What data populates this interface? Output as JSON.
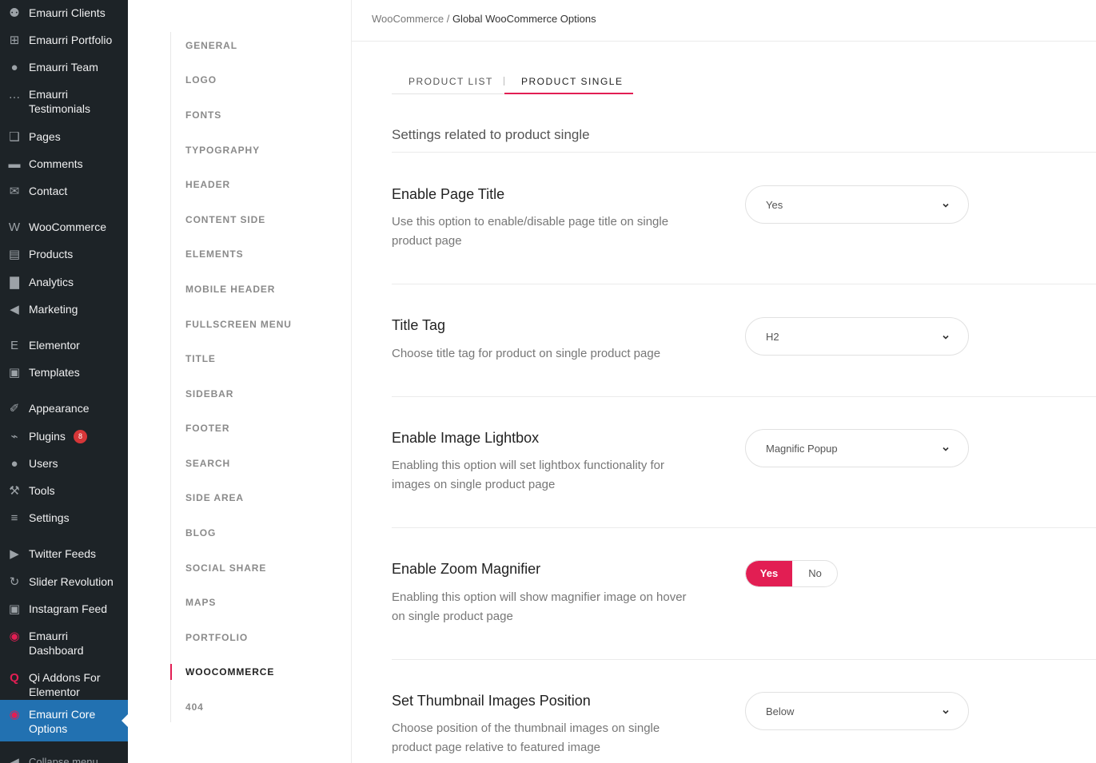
{
  "wp_menu": {
    "items": [
      {
        "label": "Emaurri Clients",
        "icon": "users-group-icon"
      },
      {
        "label": "Emaurri Portfolio",
        "icon": "grid-icon"
      },
      {
        "label": "Emaurri Team",
        "icon": "user-icon"
      },
      {
        "label": "Emaurri Testimonials",
        "icon": "speech-bubble-icon"
      },
      {
        "label": "Pages",
        "icon": "pages-icon"
      },
      {
        "label": "Comments",
        "icon": "comment-icon"
      },
      {
        "label": "Contact",
        "icon": "mail-icon"
      },
      {
        "label": "WooCommerce",
        "icon": "woo-icon"
      },
      {
        "label": "Products",
        "icon": "archive-icon"
      },
      {
        "label": "Analytics",
        "icon": "bar-chart-icon"
      },
      {
        "label": "Marketing",
        "icon": "megaphone-icon"
      },
      {
        "label": "Elementor",
        "icon": "elementor-icon"
      },
      {
        "label": "Templates",
        "icon": "folder-icon"
      },
      {
        "label": "Appearance",
        "icon": "paintbrush-icon"
      },
      {
        "label": "Plugins",
        "icon": "plug-icon",
        "badge": "8"
      },
      {
        "label": "Users",
        "icon": "user-icon"
      },
      {
        "label": "Tools",
        "icon": "wrench-icon"
      },
      {
        "label": "Settings",
        "icon": "sliders-icon"
      },
      {
        "label": "Twitter Feeds",
        "icon": "twitter-icon"
      },
      {
        "label": "Slider Revolution",
        "icon": "refresh-icon"
      },
      {
        "label": "Instagram Feed",
        "icon": "camera-icon"
      },
      {
        "label": "Emaurri Dashboard",
        "icon": "ring-icon"
      },
      {
        "label": "Qi Addons For Elementor",
        "icon": "qi-icon"
      },
      {
        "label": "Emaurri Core Options",
        "icon": "ring-icon",
        "active": true
      },
      {
        "label": "Collapse menu",
        "icon": "collapse-icon"
      }
    ]
  },
  "options_nav": {
    "items": [
      "GENERAL",
      "LOGO",
      "FONTS",
      "TYPOGRAPHY",
      "HEADER",
      "CONTENT SIDE",
      "ELEMENTS",
      "MOBILE HEADER",
      "FULLSCREEN MENU",
      "TITLE",
      "SIDEBAR",
      "FOOTER",
      "SEARCH",
      "SIDE AREA",
      "BLOG",
      "SOCIAL SHARE",
      "MAPS",
      "PORTFOLIO",
      "WOOCOMMERCE",
      "404"
    ],
    "active": "WOOCOMMERCE"
  },
  "breadcrumb": {
    "parent": "WooCommerce",
    "separator": "/",
    "current": "Global WooCommerce Options"
  },
  "tabs": [
    {
      "label": "PRODUCT LIST"
    },
    {
      "label": "PRODUCT SINGLE",
      "active": true
    }
  ],
  "section_title": "Settings related to product single",
  "options": [
    {
      "title": "Enable Page Title",
      "description": "Use this option to enable/disable page title on single product page",
      "control": "select",
      "value": "Yes"
    },
    {
      "title": "Title Tag",
      "description": "Choose title tag for product on single product page",
      "control": "select",
      "value": "H2"
    },
    {
      "title": "Enable Image Lightbox",
      "description": "Enabling this option will set lightbox functionality for images on single product page",
      "control": "select",
      "value": "Magnific Popup"
    },
    {
      "title": "Enable Zoom Magnifier",
      "description": "Enabling this option will show magnifier image on hover on single product page",
      "control": "toggle",
      "options": [
        "Yes",
        "No"
      ],
      "value": "Yes"
    },
    {
      "title": "Set Thumbnail Images Position",
      "description": "Choose position of the thumbnail images on single product page relative to featured image",
      "control": "select",
      "value": "Below"
    }
  ],
  "colors": {
    "accent": "#e21e53",
    "admin_bg": "#1d2327",
    "admin_active": "#2271b1"
  }
}
